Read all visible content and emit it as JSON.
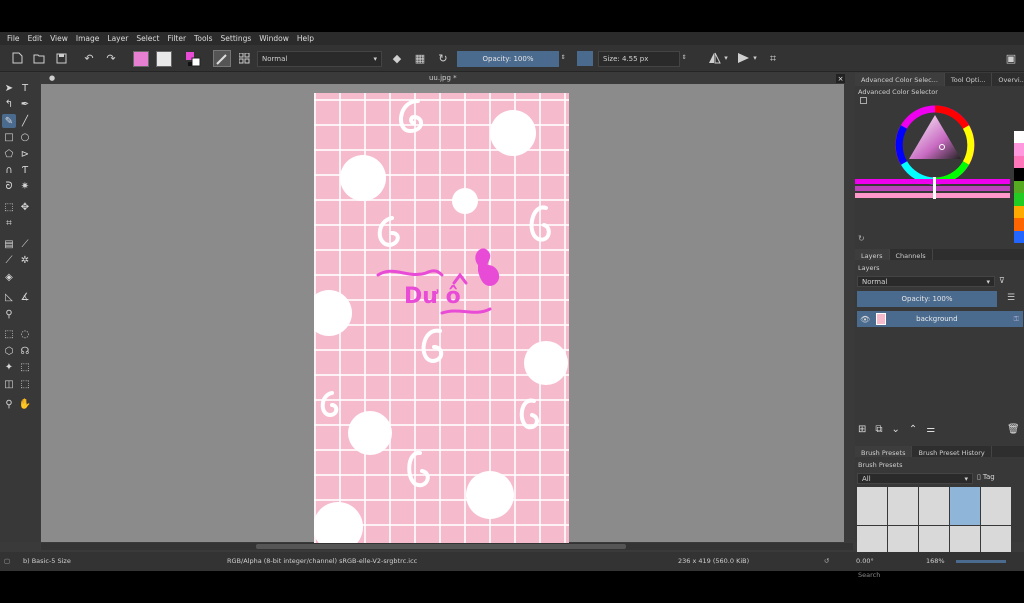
{
  "menu": [
    "File",
    "Edit",
    "View",
    "Image",
    "Layer",
    "Select",
    "Filter",
    "Tools",
    "Settings",
    "Window",
    "Help"
  ],
  "toolbar": {
    "fg_color": "#e77fd3",
    "bg_color": "#e9e9e9",
    "blend_mode": "Normal",
    "opacity_label": "Opacity: 100%",
    "size_label": "Size: 4.55 px"
  },
  "document": {
    "title": "uu.jpg *",
    "close": "×"
  },
  "canvas_image": {
    "text_main": "Dư ô",
    "colors": {
      "pink": "#f6bacd",
      "magenta": "#e84bd6",
      "white": "#ffffff"
    }
  },
  "docker": {
    "top_tabs": [
      "Advanced Color Selec...",
      "Tool Opti...",
      "Overvi..."
    ],
    "color_selector_title": "Advanced Color Selector",
    "layer_tabs": [
      "Layers",
      "Channels"
    ],
    "layers_title": "Layers",
    "layer_blend": "Normal",
    "layer_opacity": "Opacity:  100%",
    "layer_name": "background",
    "brush_tabs": [
      "Brush Presets",
      "Brush Preset History"
    ],
    "brush_title": "Brush Presets",
    "brush_filter": "All",
    "brush_tag": "Tag",
    "search_placeholder": "Search"
  },
  "status": {
    "brush": "b) Basic-5 Size",
    "color_space": "RGB/Alpha (8-bit integer/channel)  sRGB-elle-V2-srgbtrc.icc",
    "dimensions": "236 x 419 (560.0 KiB)",
    "rotation": "0.00°",
    "zoom": "168%"
  }
}
